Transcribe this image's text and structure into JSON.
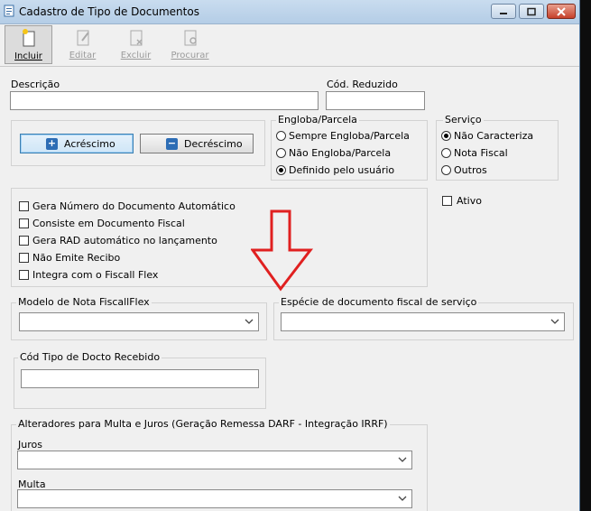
{
  "window": {
    "title": "Cadastro de Tipo de Documentos",
    "controls": {
      "minimize": "minimize",
      "maximize": "maximize",
      "close": "close"
    }
  },
  "toolbar": {
    "incluir": "Incluir",
    "editar": "Editar",
    "excluir": "Excluir",
    "procurar": "Procurar"
  },
  "form": {
    "descricao_label": "Descrição",
    "descricao_value": "",
    "cod_reduzido_label": "Cód. Reduzido",
    "cod_reduzido_value": "",
    "acrescimo_label": "Acréscimo",
    "decrescimo_label": "Decréscimo",
    "engloba": {
      "legend": "Engloba/Parcela",
      "options": [
        "Sempre Engloba/Parcela",
        "Não Engloba/Parcela",
        "Definido pelo usuário"
      ],
      "selected": 2
    },
    "servico": {
      "legend": "Serviço",
      "options": [
        "Não Caracteriza",
        "Nota Fiscal",
        "Outros"
      ],
      "selected": 0
    },
    "checks": [
      "Gera Número do Documento Automático",
      "Consiste em Documento Fiscal",
      "Gera RAD automático no lançamento",
      "Não Emite Recibo",
      "Integra com o Fiscall Flex"
    ],
    "ativo_label": "Ativo",
    "modelo_label": "Modelo de Nota FiscallFlex",
    "especie_label": "Espécie de documento fiscal de serviço",
    "cod_tipo_label": "Cód Tipo de Docto Recebido",
    "alteradores_label": "Alteradores para Multa e Juros (Geração Remessa DARF - Integração IRRF)",
    "juros_label": "Juros",
    "multa_label": "Multa"
  },
  "colors": {
    "arrow": "#e02020",
    "accent": "#2d6db5"
  },
  "icons": {
    "title": "document-icon",
    "arrow": "down-arrow-annotation"
  }
}
